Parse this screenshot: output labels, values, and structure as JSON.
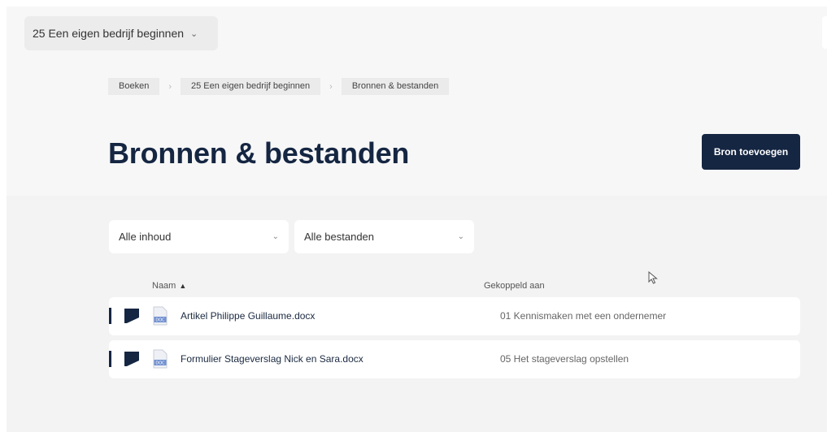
{
  "book_select": {
    "label": "25 Een eigen bedrijf beginnen"
  },
  "breadcrumb": [
    "Boeken",
    "25 Een eigen bedrijf beginnen",
    "Bronnen & bestanden"
  ],
  "page": {
    "title": "Bronnen & bestanden",
    "add_button_label": "Bron toevoegen"
  },
  "filters": {
    "content_label": "Alle inhoud",
    "files_label": "Alle bestanden"
  },
  "table": {
    "columns": {
      "name": "Naam",
      "linked": "Gekoppeld aan"
    },
    "rows": [
      {
        "file": "Artikel Philippe Guillaume.docx",
        "linked": "01 Kennismaken met een ondernemer",
        "file_type": "doc"
      },
      {
        "file": "Formulier Stageverslag Nick en Sara.docx",
        "linked": "05 Het stageverslag opstellen",
        "file_type": "doc"
      }
    ]
  },
  "icons": {
    "chevron": "chevron-down-icon",
    "sort": "sort-ascending-icon",
    "flag": "flag-icon",
    "document": "docx-file-icon",
    "cursor": "mouse-pointer-icon"
  },
  "colors": {
    "primary": "#152642",
    "background": "#f3f3f3",
    "card": "#ffffff",
    "doc_icon": "#6f8fd1"
  }
}
